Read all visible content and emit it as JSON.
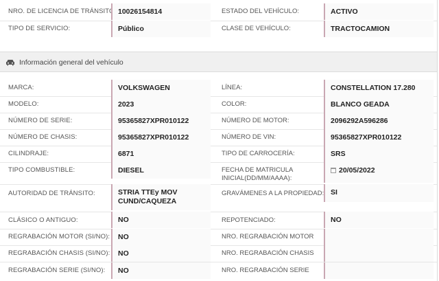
{
  "top": {
    "licencia_label": "NRO. DE LICENCIA DE TRÁNSITO:",
    "licencia_value": "10026154814",
    "estado_label": "ESTADO DEL VEHÍCULO:",
    "estado_value": "ACTIVO",
    "servicio_label": "TIPO DE SERVICIO:",
    "servicio_value": "Público",
    "clase_label": "CLASE DE VEHÍCULO:",
    "clase_value": "TRACTOCAMION"
  },
  "section": {
    "title": "Información general del vehículo",
    "icon": "car-icon"
  },
  "fields": {
    "marca_label": "MARCA:",
    "marca_value": "VOLKSWAGEN",
    "linea_label": "LÍNEA:",
    "linea_value": "CONSTELLATION 17.280",
    "modelo_label": "MODELO:",
    "modelo_value": "2023",
    "color_label": "COLOR:",
    "color_value": "BLANCO GEADA",
    "serie_label": "NÚMERO DE SERIE:",
    "serie_value": "95365827XPR010122",
    "motor_label": "NÚMERO DE MOTOR:",
    "motor_value": "2096292A596286",
    "chasis_label": "NÚMERO DE CHASIS:",
    "chasis_value": "95365827XPR010122",
    "vin_label": "NÚMERO DE VIN:",
    "vin_value": "95365827XPR010122",
    "cilindraje_label": "CILINDRAJE:",
    "cilindraje_value": "6871",
    "carroceria_label": "TIPO DE CARROCERÍA:",
    "carroceria_value": "SRS",
    "combustible_label": "TIPO COMBUSTIBLE:",
    "combustible_value": "DIESEL",
    "matricula_label_1": "FECHA DE MATRICULA",
    "matricula_label_2": "INICIAL(DD/MM/AAAA):",
    "matricula_value": "20/05/2022",
    "autoridad_label": "AUTORIDAD DE TRÁNSITO:",
    "autoridad_value_1": "STRIA TTEy MOV",
    "autoridad_value_2": "CUND/CAQUEZA",
    "gravamenes_label": "GRAVÁMENES A LA PROPIEDAD:",
    "gravamenes_value": "SI",
    "clasico_label": "CLÁSICO O ANTIGUO:",
    "clasico_value": "NO",
    "repotenciado_label": "REPOTENCIADO:",
    "repotenciado_value": "NO",
    "reg_motor_label": "REGRABACIÓN MOTOR (SI/NO):",
    "reg_motor_value": "NO",
    "nro_reg_motor_label": "NRO. REGRABACIÓN MOTOR",
    "reg_chasis_label": "REGRABACIÓN CHASIS (SI/NO):",
    "reg_chasis_value": "NO",
    "nro_reg_chasis_label": "NRO. REGRABACIÓN CHASIS",
    "reg_serie_label": "REGRABACIÓN SERIE (SI/NO):",
    "reg_serie_value": "NO",
    "nro_reg_serie_label": "NRO. REGRABACIÓN SERIE"
  }
}
